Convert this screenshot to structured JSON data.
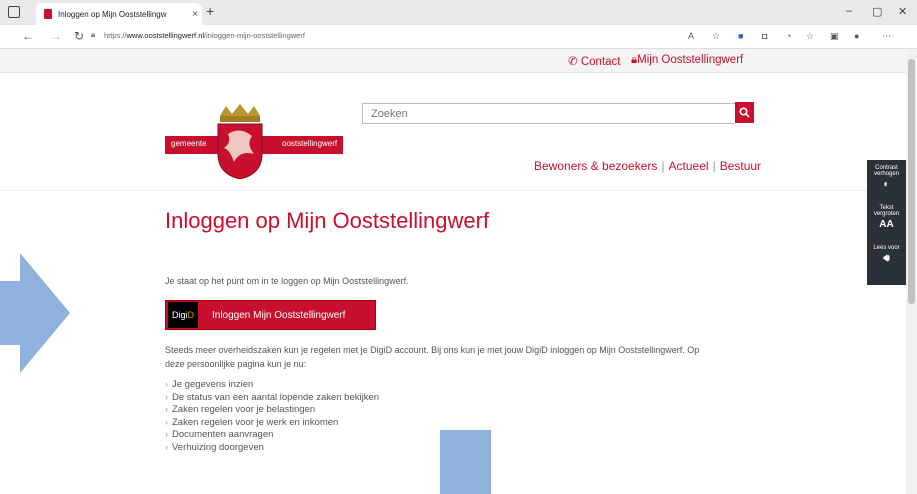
{
  "browser": {
    "tab_title": "Inloggen op Mijn Ooststellingw",
    "tab_close": "×",
    "new_tab": "+",
    "url_prefix": "https://",
    "url_host": "www.ooststellingwerf.nl",
    "url_path": "/inloggen-mijn-ooststellingwerf",
    "window_controls": [
      "–",
      "▢",
      "✕"
    ]
  },
  "util_links": {
    "contact": "Contact",
    "mijn": "Mijn Ooststellingwerf"
  },
  "logo": {
    "left_text": "gemeente",
    "right_text": "ooststellingwerf"
  },
  "search": {
    "placeholder": "Zoeken"
  },
  "nav": {
    "items": [
      "Bewoners & bezoekers",
      "Actueel",
      "Bestuur"
    ],
    "separator": "|"
  },
  "content": {
    "title": "Inloggen op Mijn Ooststellingwerf",
    "intro": "Je staat op het punt om in te loggen op Mijn Ooststellingwerf.",
    "digid_logo_a": "Digi",
    "digid_logo_b": "D",
    "login_button": "Inloggen Mijn Ooststellingwerf",
    "paragraph": "Steeds meer overheidszaken kun je regelen met je DigiD account. Bij ons kun je met jouw DigiD inloggen op Mijn Ooststellingwerf. Op deze persoonlijke pagina kun je nu:",
    "bullets": [
      "Je gegevens inzien",
      "De status van een aantal lopende zaken bekijken",
      "Zaken regelen voor je belastingen",
      "Zaken regelen voor je werk en inkomen",
      "Documenten aanvragen",
      "Verhuizing doorgeven"
    ]
  },
  "a11y": {
    "contrast": "Contrast verhogen",
    "text_size": "Tekst vergroten",
    "read": "Lees voor",
    "text_icon": "AA"
  },
  "colors": {
    "brand_red": "#c8102e",
    "arrow_blue": "#8fb1de",
    "panel_dark": "#2a3138"
  }
}
